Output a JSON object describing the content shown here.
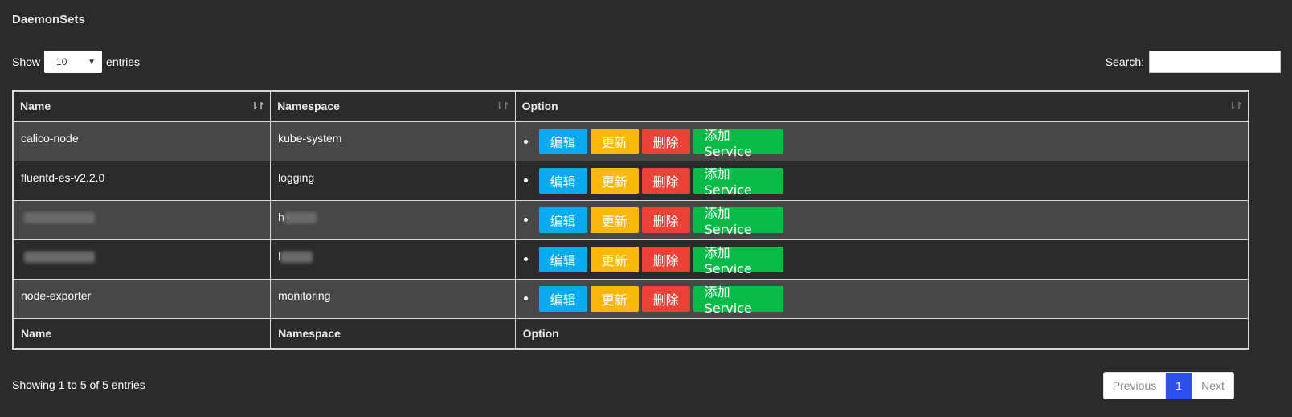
{
  "page": {
    "title": "DaemonSets"
  },
  "length": {
    "prefix": "Show",
    "value": "10",
    "suffix": "entries"
  },
  "search": {
    "label": "Search:",
    "value": ""
  },
  "table": {
    "columns": [
      "Name",
      "Namespace",
      "Option"
    ],
    "rows": [
      {
        "name": "calico-node",
        "namespace": "kube-system"
      },
      {
        "name": "fluentd-es-v2.2.0",
        "namespace": "logging"
      },
      {
        "name": "",
        "namespace": "h"
      },
      {
        "name": "",
        "namespace": "l"
      },
      {
        "name": "node-exporter",
        "namespace": "monitoring"
      }
    ],
    "actions": {
      "edit": "编辑",
      "update": "更新",
      "delete": "删除",
      "add_service": "添加Service"
    }
  },
  "footer": {
    "info": "Showing 1 to 5 of 5 entries",
    "pagination": {
      "previous": "Previous",
      "current": "1",
      "next": "Next"
    }
  },
  "colors": {
    "background": "#2b2b2b",
    "row_odd": "#474747",
    "edit": "#0aaaf0",
    "update": "#fbb80b",
    "delete": "#ec4136",
    "add_service": "#08bb49",
    "page_active": "#2e4fe9"
  }
}
